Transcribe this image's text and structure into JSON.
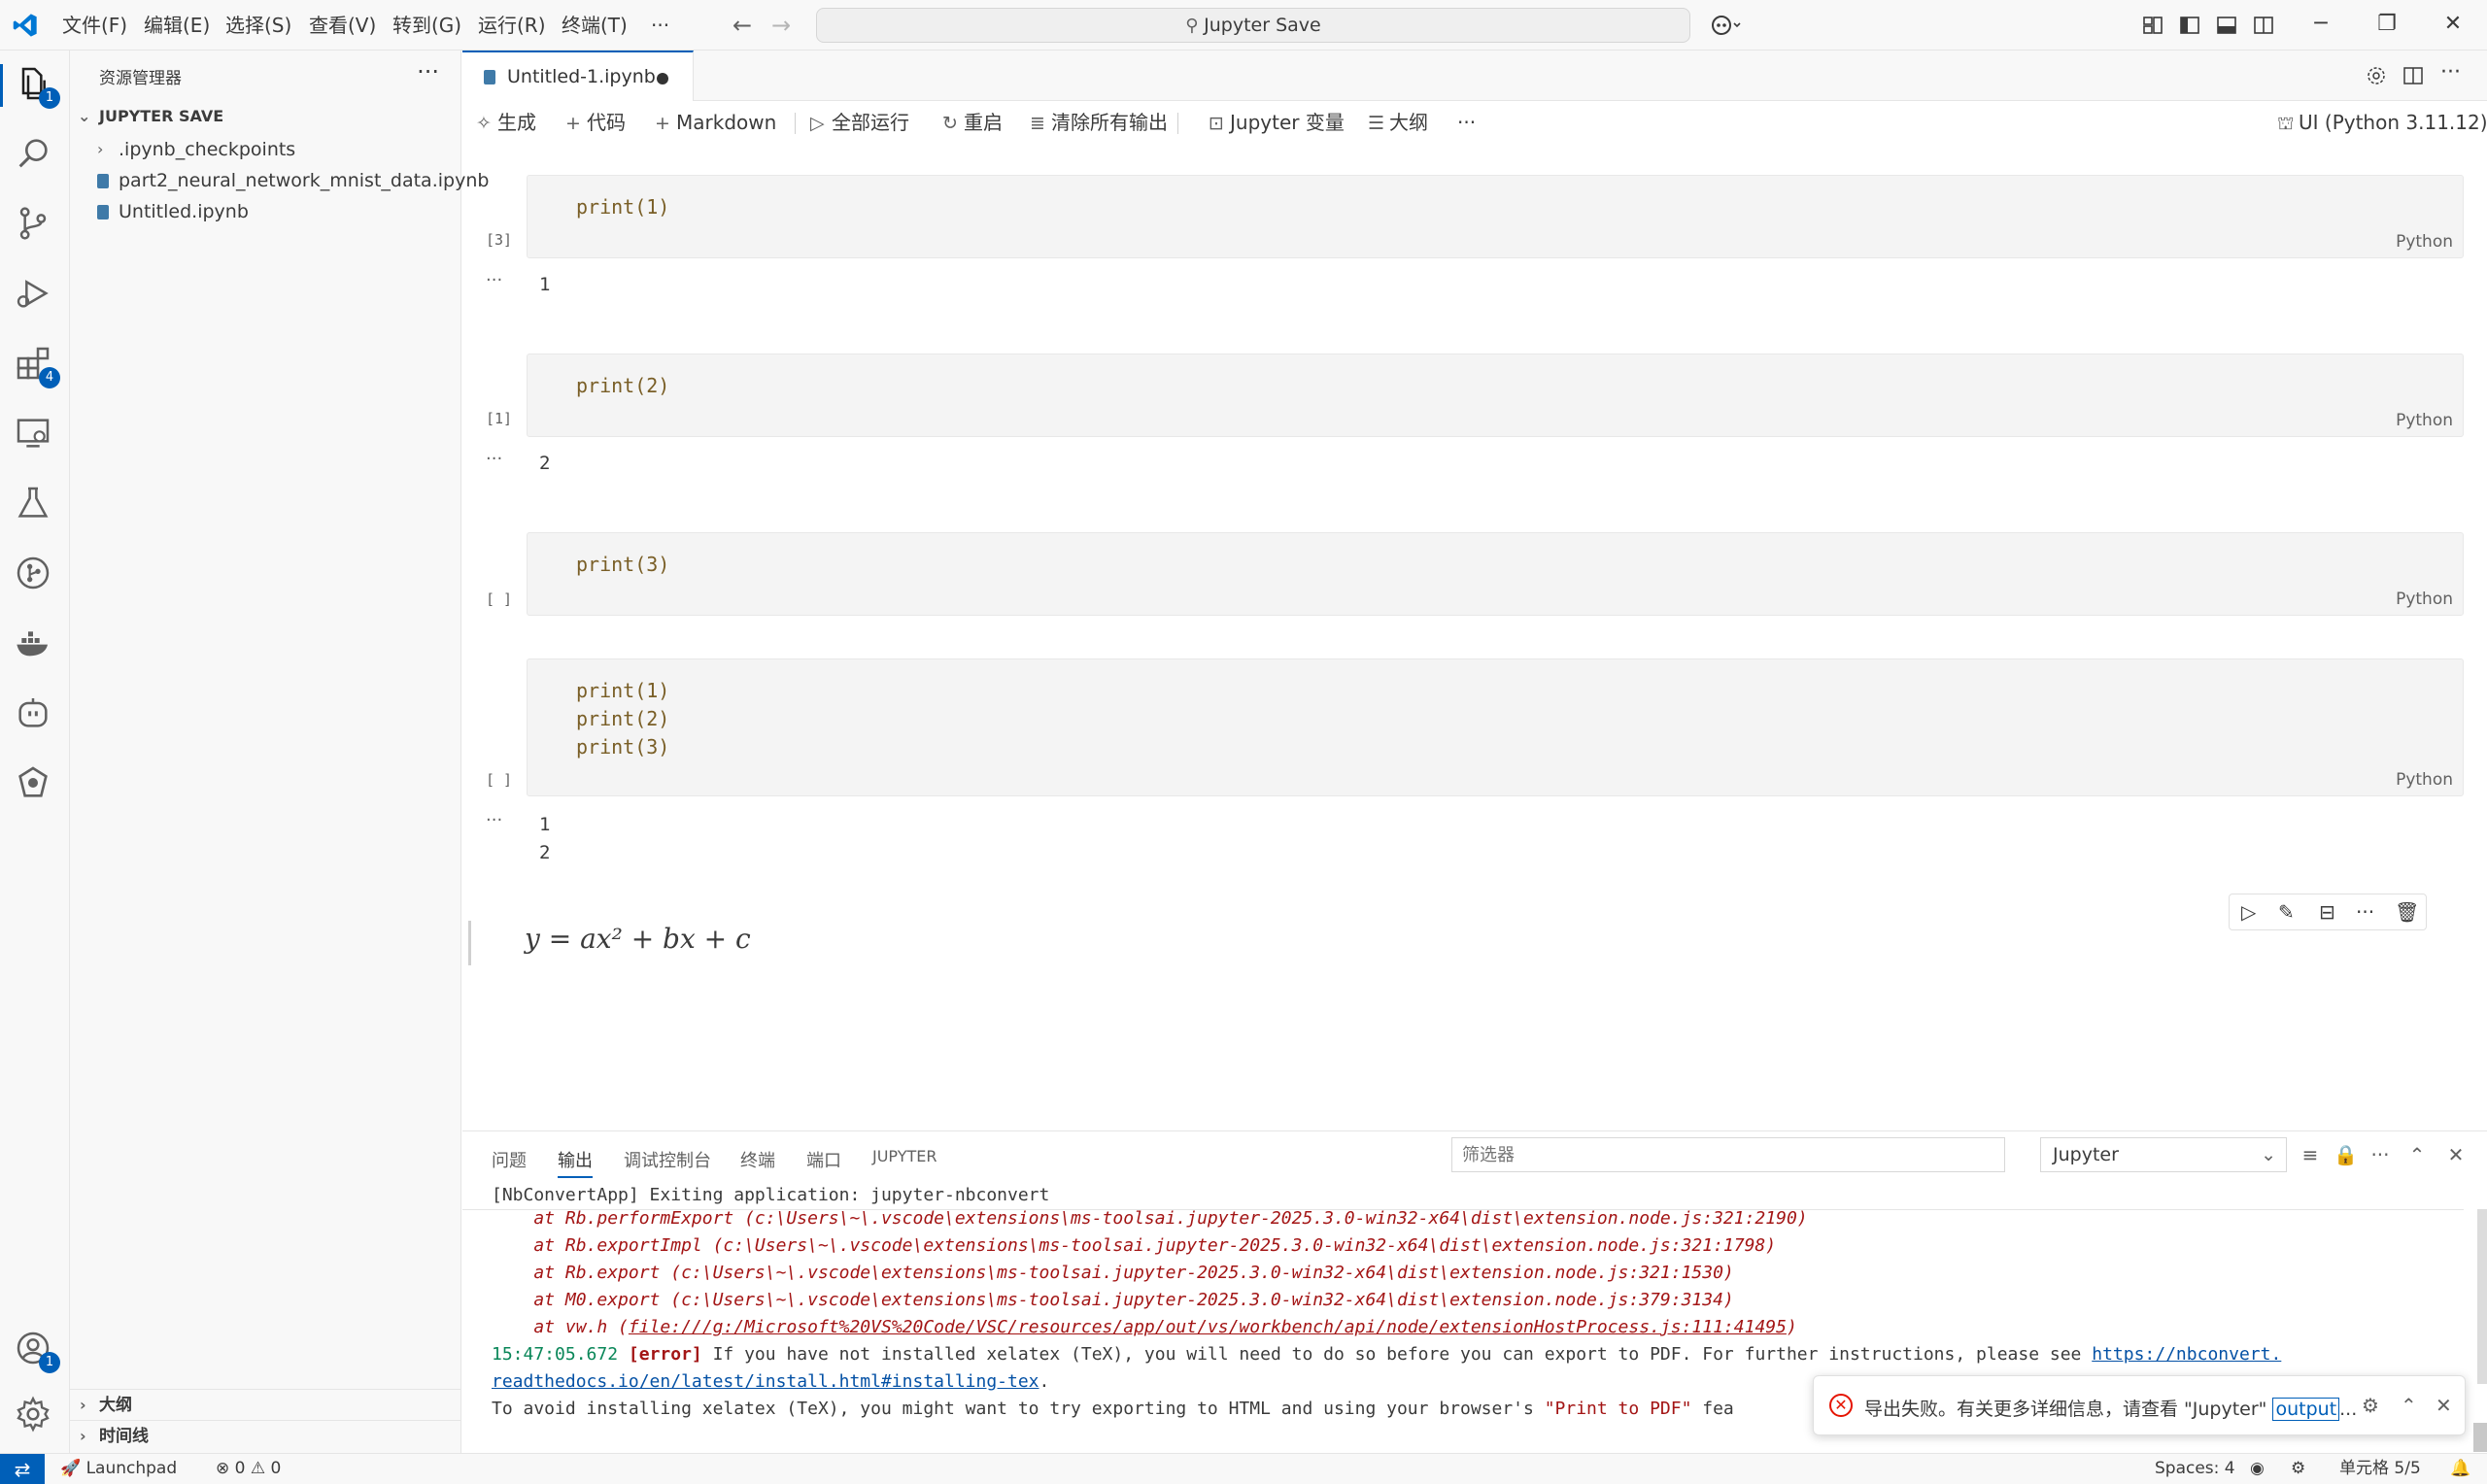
{
  "titlebar": {
    "menus": [
      "文件(F)",
      "编辑(E)",
      "选择(S)",
      "查看(V)",
      "转到(G)",
      "运行(R)",
      "终端(T)",
      "···"
    ],
    "search": "Jupyter Save"
  },
  "sidebar": {
    "title": "资源管理器",
    "section": "JUPYTER SAVE",
    "items": [
      ".ipynb_checkpoints",
      "part2_neural_network_mnist_data.ipynb",
      "Untitled.ipynb"
    ],
    "bottom_sections": [
      "大纲",
      "时间线"
    ]
  },
  "activity_badges": {
    "explorer": "1",
    "extensions": "4",
    "accounts": "1"
  },
  "editor": {
    "tab_label": "Untitled-1.ipynb"
  },
  "toolbar": {
    "generate": "生成",
    "code": "代码",
    "markdown": "Markdown",
    "run_all": "全部运行",
    "restart": "重启",
    "clear_outputs": "清除所有输出",
    "variables": "Jupyter 变量",
    "outline": "大纲",
    "more": "···",
    "kernel": "UI (Python 3.11.12)"
  },
  "cells": [
    {
      "exec": "[3]",
      "code": [
        "print(1)"
      ],
      "lang": "Python",
      "output": [
        "1"
      ]
    },
    {
      "exec": "[1]",
      "code": [
        "print(2)"
      ],
      "lang": "Python",
      "output": [
        "2"
      ]
    },
    {
      "exec": "[ ]",
      "code": [
        "print(3)"
      ],
      "lang": "Python",
      "output": []
    },
    {
      "exec": "[ ]",
      "code": [
        "print(1)",
        "print(2)",
        "print(3)"
      ],
      "lang": "Python",
      "output": [
        "1",
        "2"
      ]
    }
  ],
  "markdown_cell": {
    "math": "y = ax² + bx + c"
  },
  "panel": {
    "tabs": [
      "问题",
      "输出",
      "调试控制台",
      "终端",
      "端口",
      "JUPYTER"
    ],
    "filter_placeholder": "筛选器",
    "channel": "Jupyter",
    "lines": {
      "l0": "[NbConvertApp] Exiting application: jupyter-nbconvert",
      "l1": "    at Rb.performExport (c:\\Users\\~\\.vscode\\extensions\\ms-toolsai.jupyter-2025.3.0-win32-x64\\dist\\extension.node.js:321:2190)",
      "l2": "    at Rb.exportImpl (c:\\Users\\~\\.vscode\\extensions\\ms-toolsai.jupyter-2025.3.0-win32-x64\\dist\\extension.node.js:321:1798)",
      "l3": "    at Rb.export (c:\\Users\\~\\.vscode\\extensions\\ms-toolsai.jupyter-2025.3.0-win32-x64\\dist\\extension.node.js:321:1530)",
      "l4": "    at M0.export (c:\\Users\\~\\.vscode\\extensions\\ms-toolsai.jupyter-2025.3.0-win32-x64\\dist\\extension.node.js:379:3134)",
      "l5_prefix": "    at vw.h (",
      "l5_link": "file:///g:/Microsoft%20VS%20Code/VSC/resources/app/out/vs/workbench/api/node/extensionHostProcess.js:111:41495",
      "l5_suffix": ")",
      "l6_ts": "15:47:05.672",
      "l6_tag": "[error]",
      "l6_text": " If you have not installed xelatex (TeX), you will need to do so before you can export to PDF. For further instructions, please see ",
      "l6_url1": "https://nbconvert.",
      "l7_url2": "readthedocs.io/en/latest/install.html#installing-tex",
      "l7_tail": ".",
      "l8_text": "To avoid installing xelatex (TeX), you might want to try exporting to HTML and using your browser's ",
      "l8_str": "\"Print to PDF\"",
      "l8_tail": " fea"
    }
  },
  "notification": {
    "message": "导出失败。有关更多详细信息，请查看 \"Jupyter\" ",
    "link": "output",
    "ellipsis": "..."
  },
  "statusbar": {
    "launchpad": "Launchpad",
    "problems": "⊗ 0 ⚠ 0",
    "spaces": "Spaces: 4",
    "cell": "单元格 5/5"
  },
  "colors": {
    "accent": "#005fb8",
    "error": "#e51400"
  }
}
